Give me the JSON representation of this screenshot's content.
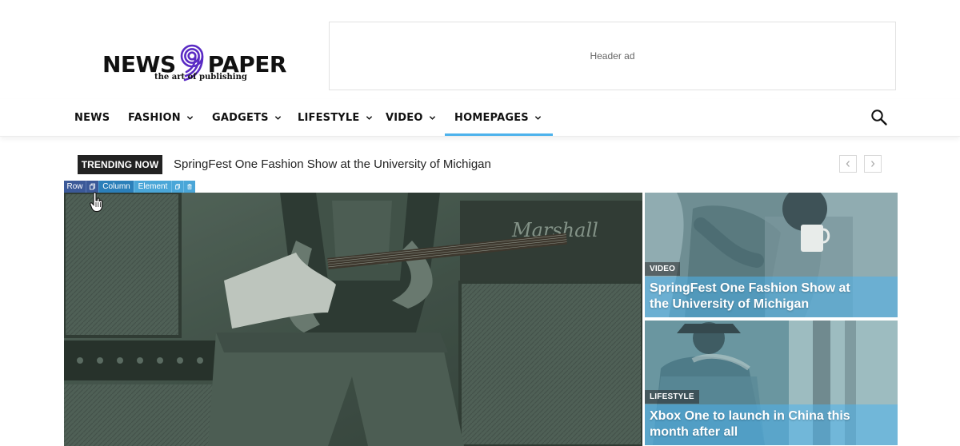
{
  "brand": {
    "logo_word_left": "NEWS",
    "logo_digit": "9",
    "logo_word_right": "PAPER",
    "tagline": "the art of publishing",
    "accent_color": "#4db2ec",
    "logo_nine_color": "#5a2bc4"
  },
  "header_ad": {
    "label": "Header ad"
  },
  "nav": {
    "items": [
      {
        "label": "NEWS",
        "has_dropdown": false
      },
      {
        "label": "FASHION",
        "has_dropdown": true
      },
      {
        "label": "GADGETS",
        "has_dropdown": true
      },
      {
        "label": "LIFESTYLE",
        "has_dropdown": true
      },
      {
        "label": "VIDEO",
        "has_dropdown": true
      },
      {
        "label": "HOMEPAGES",
        "has_dropdown": true,
        "active": true
      }
    ],
    "search_icon": "search-icon"
  },
  "trending": {
    "badge": "TRENDING NOW",
    "headline": "SpringFest One Fashion Show at the University of Michigan",
    "prev_icon": "chevron-left-icon",
    "next_icon": "chevron-right-icon"
  },
  "editor_toolbar": {
    "row_label": "Row",
    "column_label": "Column",
    "element_label": "Element"
  },
  "featured": {
    "main": {
      "image_desc": "guitarist-with-amplifiers"
    },
    "side": [
      {
        "category": "VIDEO",
        "title": "SpringFest One Fashion Show at the University of Michigan"
      },
      {
        "category": "LIFESTYLE",
        "title": "Xbox One to launch in China this month after all"
      }
    ]
  }
}
